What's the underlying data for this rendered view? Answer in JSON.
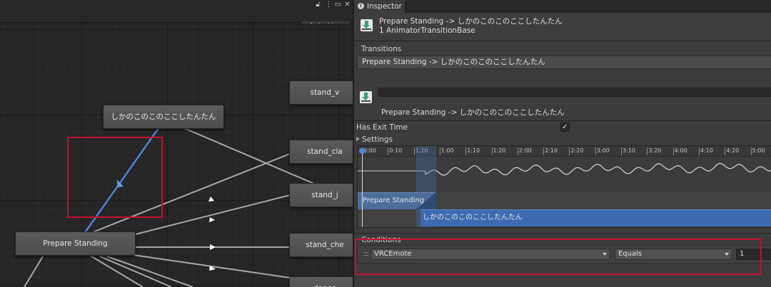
{
  "animator": {
    "toolbar": {
      "auto_live_link": "Auto Live Link",
      "icons": [
        "lock-icon",
        "kebab-menu-icon",
        "maximize-icon",
        "close-icon"
      ]
    },
    "nodes": {
      "target_state": "しかのこのこのここしたんたん",
      "prepare_standing": "Prepare Standing",
      "stand_1": "stand_v",
      "stand_2": "stand_cla",
      "stand_3": "stand_j",
      "stand_4": "stand_che",
      "dance": "dance"
    }
  },
  "inspector": {
    "tab_label": "Inspector",
    "header": {
      "title": "Prepare Standing -> しかのこのこのここしたんたん",
      "subtitle": "1 AnimatorTransitionBase"
    },
    "transitions_label": "Transitions",
    "transitions": [
      "Prepare Standing -> しかのこのこのここしたんたん"
    ],
    "transition_name_value": "",
    "transition_title": "Prepare Standing -> しかのこのこのここしたんたん",
    "has_exit_time_label": "Has Exit Time",
    "has_exit_time_checked": "✓",
    "settings_label": "Settings",
    "timeline": {
      "ticks": [
        "0:00",
        "0:10",
        "1:20",
        "1:00",
        "1:10",
        "1:20",
        "2:00",
        "2:10",
        "2:20",
        "3:00",
        "3:10",
        "3:20",
        "4:00",
        "4:10",
        "4:20",
        "5:00"
      ],
      "source_clip": "Prepare Standing",
      "destination_clip": "しかのこのこのここしたんたん"
    },
    "conditions_label": "Conditions",
    "condition": {
      "parameter": "VRCEmote",
      "mode": "Equals",
      "threshold": "1"
    }
  },
  "colors": {
    "highlight_red": "#c8102e",
    "transition_selected_blue": "#4f87d9",
    "clip_blue": "#3d6bb1"
  }
}
